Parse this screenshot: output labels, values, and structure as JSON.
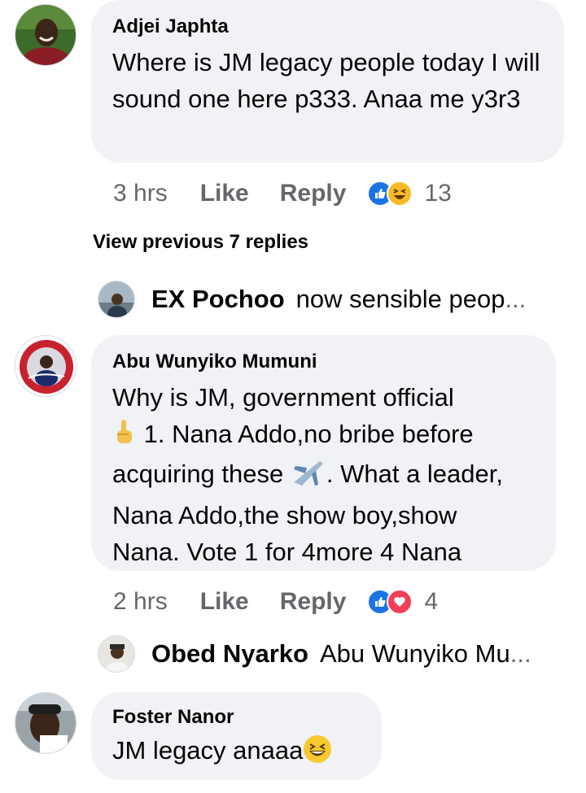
{
  "comments": [
    {
      "author": "Adjei Japhta",
      "text": "Where is JM legacy people today I will sound one here p333. Anaa me y3r3",
      "time": "3 hrs",
      "like_label": "Like",
      "reply_label": "Reply",
      "reaction_icons": [
        "like-reaction-icon",
        "haha-reaction-icon"
      ],
      "reaction_count": "13"
    },
    {
      "author": "Abu Wunyiko Mumuni",
      "text_line1": "Why is JM, government official",
      "text_line2": " 1. Nana Addo,no bribe before",
      "text_line3a": "acquiring these ",
      "text_line3b": ". What a leader,",
      "text_line4": "Nana Addo,the show boy,show",
      "text_line5": "Nana. Vote 1 for 4more 4 Nana",
      "time": "2 hrs",
      "like_label": "Like",
      "reply_label": "Reply",
      "reaction_icons": [
        "like-reaction-icon",
        "love-reaction-icon"
      ],
      "reaction_count": "4"
    },
    {
      "author": "Foster Nanor",
      "text": "JM legacy anaaa"
    }
  ],
  "view_previous": "View previous 7 replies",
  "replies": [
    {
      "author": "EX Pochoo",
      "text": "now sensible peop",
      "ellipsis": "..."
    },
    {
      "author": "Obed Nyarko",
      "text": "Abu Wunyiko Mu",
      "ellipsis": "..."
    }
  ],
  "colors": {
    "bubble": "#f0f2f5",
    "meta_text": "#65676b",
    "like_blue": "#1b74e4",
    "haha_yellow": "#f7b928",
    "love_red": "#f33e58"
  }
}
